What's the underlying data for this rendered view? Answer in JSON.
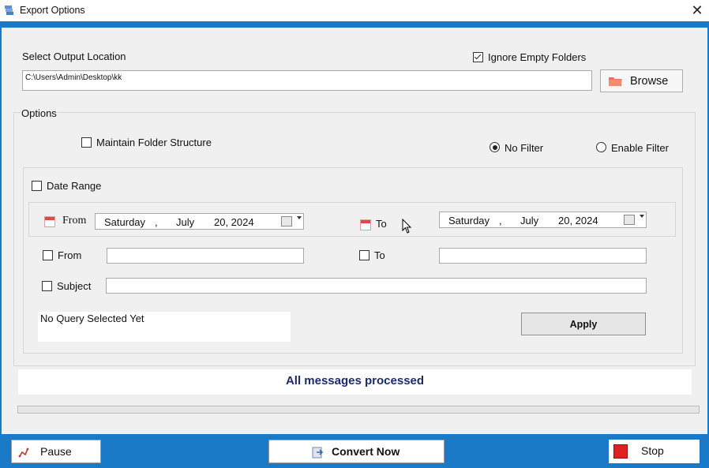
{
  "window": {
    "title": "Export Options",
    "close_glyph": "✕"
  },
  "output": {
    "label": "Select Output Location",
    "path": "C:\\Users\\Admin\\Desktop\\kk",
    "ignore_empty_label": "Ignore Empty Folders",
    "ignore_empty_checked": true,
    "browse_label": "Browse",
    "browse_icon": "folder-icon"
  },
  "options": {
    "group_label": "Options",
    "maintain_folder_label": "Maintain Folder Structure",
    "maintain_folder_checked": false,
    "no_filter_label": "No Filter",
    "enable_filter_label": "Enable Filter",
    "selected_filter": "No Filter"
  },
  "filter": {
    "date_range_label": "Date Range",
    "date_range_checked": false,
    "from_label": "From",
    "to_label": "To",
    "from_date": {
      "day": "Saturday",
      "sep": ",",
      "month": "July",
      "date": "20, 2024"
    },
    "to_date": {
      "day": "Saturday",
      "sep": ",",
      "month": "July",
      "date": "20, 2024"
    },
    "from_field_label": "From",
    "to_field_label": "To",
    "subject_label": "Subject",
    "from_value": "",
    "to_value": "",
    "subject_value": "",
    "query_text": "No Query Selected Yet",
    "apply_label": "Apply"
  },
  "status": {
    "message": "All messages processed",
    "color": "#1b2a6b",
    "progress": 0
  },
  "footer": {
    "pause_label": "Pause",
    "convert_label": "Convert Now",
    "stop_label": "Stop"
  },
  "colors": {
    "accent": "#1a7ac8",
    "stop_red": "#e02020"
  }
}
